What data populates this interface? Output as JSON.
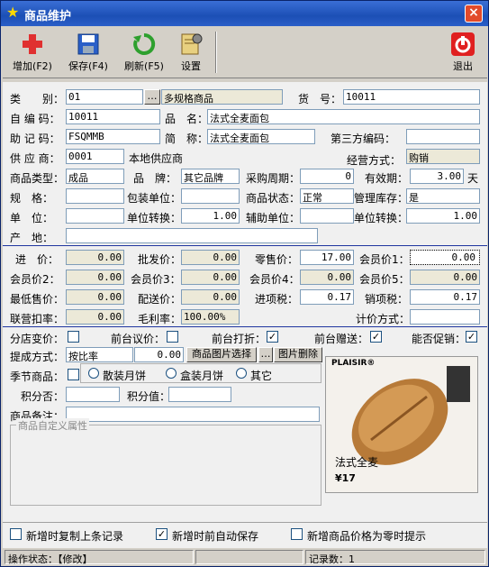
{
  "window": {
    "title": "商品维护",
    "close": "×"
  },
  "toolbar": {
    "add": "增加(F2)",
    "save": "保存(F4)",
    "refresh": "刷新(F5)",
    "settings": "设置",
    "exit": "退出"
  },
  "form": {
    "category_label": "类　　别：",
    "category_code": "01",
    "category_btn": "…",
    "category_name": "多规格商品",
    "item_no_label": "货　号：",
    "item_no": "10011",
    "self_code_label": "自 编 码：",
    "self_code": "10011",
    "name_label": "品　名：",
    "name": "法式全麦面包",
    "mnemonic_label": "助 记 码：",
    "mnemonic": "FSQMMB",
    "short_label": "简　称：",
    "short_name": "法式全麦面包",
    "third_label": "第三方编码：",
    "third_code": "",
    "supplier_label": "供 应 商：",
    "supplier_code": "0001",
    "supplier_name": "本地供应商",
    "mode_label": "经营方式：",
    "mode": "购销",
    "type_label": "商品类型：",
    "type": "成品",
    "brand_label": "品　牌：",
    "brand": "其它品牌",
    "cycle_label": "采购周期：",
    "cycle": "0",
    "valid_label": "有效期：",
    "valid": "3.00",
    "valid_unit": "天",
    "spec_label": "规　格：",
    "spec": "",
    "pack_label": "包装单位：",
    "pack": "",
    "status_label": "商品状态：",
    "status": "正常",
    "stock_label": "管理库存：",
    "stock": "是",
    "unit_label": "单　位：",
    "unit": "",
    "conv_label": "单位转换：",
    "conv": "1.00",
    "aux_label": "辅助单位：",
    "aux": "",
    "conv2_label": "单位转换：",
    "conv2": "1.00",
    "origin_label": "产　地：",
    "origin": ""
  },
  "prices": {
    "purchase_label": "进　价：",
    "purchase": "0.00",
    "wholesale_label": "批发价：",
    "wholesale": "0.00",
    "retail_label": "零售价：",
    "retail": "17.00",
    "member1_label": "会员价1：",
    "member1": "0.00",
    "member2_label": "会员价2：",
    "member2": "0.00",
    "member3_label": "会员价3：",
    "member3": "0.00",
    "member4_label": "会员价4：",
    "member4": "0.00",
    "member5_label": "会员价5：",
    "member5": "0.00",
    "min_label": "最低售价：",
    "min": "0.00",
    "dist_label": "配送价：",
    "dist": "0.00",
    "intax_label": "进项税：",
    "intax": "0.17",
    "outtax_label": "销项税：",
    "outtax": "0.17",
    "jointrate_label": "联营扣率：",
    "jointrate": "0.00",
    "margin_label": "毛利率：",
    "margin": "100.00%",
    "pricemode_label": "计价方式：",
    "pricemode": ""
  },
  "options": {
    "store_price": "分店变价：",
    "front_price": "前台议价：",
    "front_discount": "前台打折：",
    "front_gift": "前台赠送：",
    "promo": "能否促销：",
    "commission_label": "提成方式：",
    "commission": "按比率",
    "commission_val": "0.00",
    "pic_select": "商品图片选择",
    "pic_btn": "…",
    "pic_delete": "图片删除",
    "season_label": "季节商品：",
    "season_opt1": "散装月饼",
    "season_opt2": "盒装月饼",
    "season_opt3": "其它",
    "points_label": "积分否：",
    "points_value_label": "积分值：",
    "remark_label": "商品备注：",
    "custom_group": "商品自定义属性"
  },
  "image": {
    "brand": "PLAISIR®",
    "product": "法式全麦",
    "price": "¥17"
  },
  "bottom": {
    "copy_last": "新增时复制上条记录",
    "auto_save": "新增时前自动保存",
    "price_zero": "新增商品价格为零时提示"
  },
  "statusbar": {
    "op_state": "操作状态：【修改】",
    "records": "记录数：1"
  },
  "colors": {
    "title": "#1c4fb5",
    "accent": "#2036a0"
  }
}
